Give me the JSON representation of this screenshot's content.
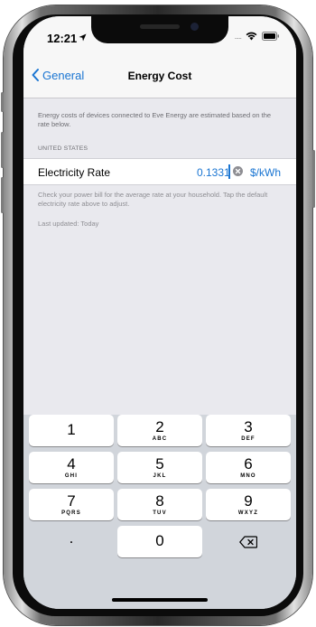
{
  "status": {
    "time": "12:21",
    "signal_dots": "....."
  },
  "nav": {
    "back_label": "General",
    "title": "Energy Cost"
  },
  "content": {
    "description": "Energy costs of devices connected to Eve Energy are estimated based on the rate below.",
    "section_header": "UNITED STATES",
    "rate_label": "Electricity Rate",
    "rate_value": "0.1331",
    "rate_unit": "$/kWh",
    "help_text": "Check your power bill for the average rate at your household. Tap the default electricity rate above to adjust.",
    "last_updated": "Last updated: Today"
  },
  "keypad": {
    "keys": [
      {
        "num": "1",
        "letters": ""
      },
      {
        "num": "2",
        "letters": "ABC"
      },
      {
        "num": "3",
        "letters": "DEF"
      },
      {
        "num": "4",
        "letters": "GHI"
      },
      {
        "num": "5",
        "letters": "JKL"
      },
      {
        "num": "6",
        "letters": "MNO"
      },
      {
        "num": "7",
        "letters": "PQRS"
      },
      {
        "num": "8",
        "letters": "TUV"
      },
      {
        "num": "9",
        "letters": "WXYZ"
      },
      {
        "num": "0",
        "letters": ""
      }
    ],
    "decimal": ".",
    "delete_icon": "backspace-icon"
  },
  "colors": {
    "accent": "#1a75d2",
    "background": "#e9e9ee",
    "keyboard": "#d1d5db"
  }
}
